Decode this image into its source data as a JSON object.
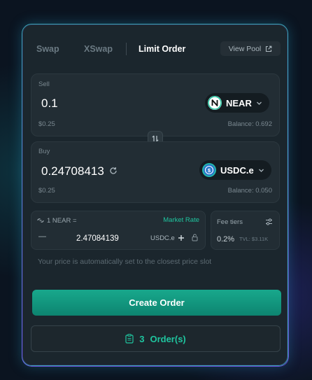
{
  "tabs": [
    {
      "label": "Swap"
    },
    {
      "label": "XSwap"
    },
    {
      "label": "Limit Order"
    }
  ],
  "view_pool": {
    "label": "View Pool"
  },
  "sell": {
    "label": "Sell",
    "amount": "0.1",
    "usd_value": "$0.25",
    "balance": "Balance: 0.692",
    "token": {
      "symbol": "NEAR",
      "icon": "near-logo-icon"
    }
  },
  "buy": {
    "label": "Buy",
    "amount": "0.24708413",
    "usd_value": "$0.25",
    "balance": "Balance: 0.050",
    "token": {
      "symbol": "USDC.e",
      "icon": "usdc-logo-icon"
    }
  },
  "rate": {
    "base": "1 NEAR =",
    "market_rate_label": "Market Rate",
    "price": "2.47084139",
    "quote_token": "USDC.e",
    "minus": "—"
  },
  "fee": {
    "label": "Fee tiers",
    "value": "0.2%",
    "tvl": "TVL: $3.11K"
  },
  "hint": "Your price is automatically set to the closest price slot",
  "create_order": {
    "label": "Create Order"
  },
  "orders": {
    "count": "3",
    "label": "Order(s)"
  },
  "colors": {
    "accent": "#1fc59f",
    "button": "#11977e",
    "card_border": "#3aa6b6",
    "panel": "#222d34"
  }
}
